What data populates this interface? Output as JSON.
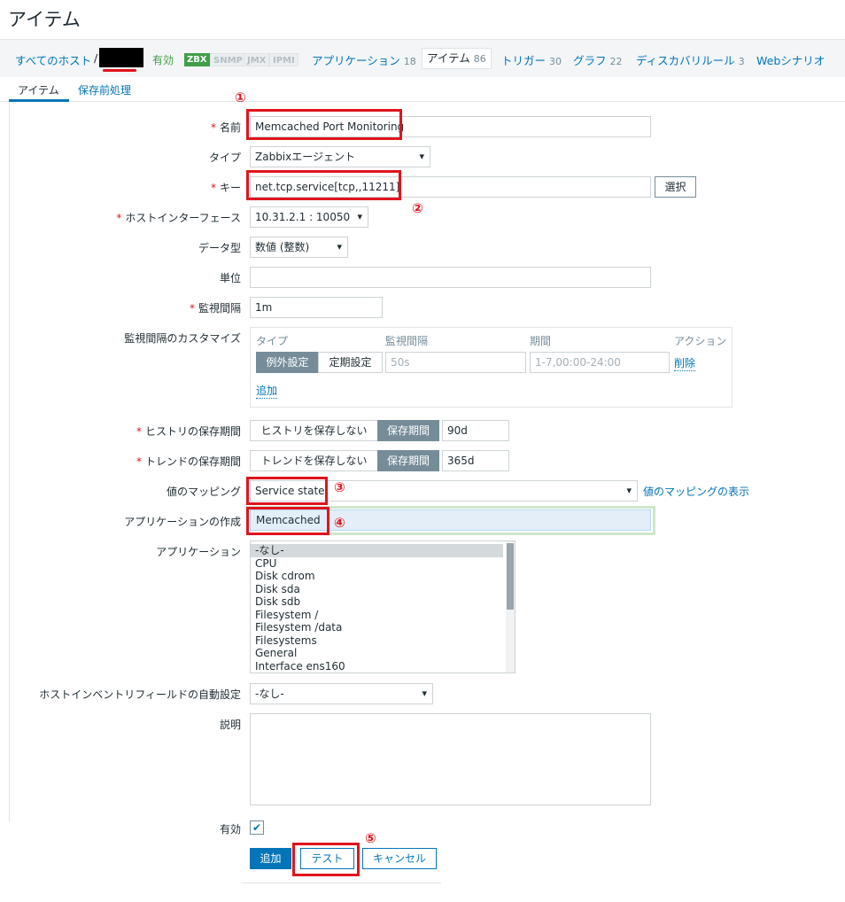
{
  "page": {
    "title": "アイテム"
  },
  "nav": {
    "all_hosts": "すべてのホスト",
    "sep": "/",
    "status": "有効",
    "protocols": [
      "ZBX",
      "SNMP",
      "JMX",
      "IPMI"
    ],
    "links": [
      {
        "label": "アプリケーション",
        "count": "18"
      },
      {
        "label": "アイテム",
        "count": "86"
      },
      {
        "label": "トリガー",
        "count": "30"
      },
      {
        "label": "グラフ",
        "count": "22"
      },
      {
        "label": "ディスカバリルール",
        "count": "3"
      },
      {
        "label": "Webシナリオ",
        "count": ""
      }
    ]
  },
  "tabs": {
    "item": "アイテム",
    "preprocessing": "保存前処理"
  },
  "form": {
    "name_label": "名前",
    "name_value": "Memcached Port Monitoring",
    "type_label": "タイプ",
    "type_value": "Zabbixエージェント",
    "key_label": "キー",
    "key_value": "net.tcp.service[tcp,,11211]",
    "key_select_button": "選択",
    "interface_label": "ホストインターフェース",
    "interface_value": "10.31.2.1 : 10050",
    "datatype_label": "データ型",
    "datatype_value": "数値 (整数)",
    "units_label": "単位",
    "units_value": "",
    "interval_label": "監視間隔",
    "interval_value": "1m",
    "custom_label": "監視間隔のカスタマイズ",
    "custom": {
      "col_type": "タイプ",
      "col_interval": "監視間隔",
      "col_period": "期間",
      "col_action": "アクション",
      "type_flexible": "例外設定",
      "type_scheduling": "定期設定",
      "interval_placeholder": "50s",
      "period_placeholder": "1-7,00:00-24:00",
      "remove": "削除",
      "add": "追加"
    },
    "history_label": "ヒストリの保存期間",
    "history_nostore": "ヒストリを保存しない",
    "history_store": "保存期間",
    "history_value": "90d",
    "trends_label": "トレンドの保存期間",
    "trends_nostore": "トレンドを保存しない",
    "trends_store": "保存期間",
    "trends_value": "365d",
    "valuemap_label": "値のマッピング",
    "valuemap_value": "Service state",
    "valuemap_link": "値のマッピングの表示",
    "newapp_label": "アプリケーションの作成",
    "newapp_value": "Memcached",
    "apps_label": "アプリケーション",
    "apps": [
      "-なし-",
      "CPU",
      "Disk cdrom",
      "Disk sda",
      "Disk sdb",
      "Filesystem /",
      "Filesystem /data",
      "Filesystems",
      "General",
      "Interface ens160"
    ],
    "inventory_label": "ホストインベントリフィールドの自動設定",
    "inventory_value": "-なし-",
    "description_label": "説明",
    "enabled_label": "有効",
    "buttons": {
      "add": "追加",
      "test": "テスト",
      "cancel": "キャンセル"
    }
  },
  "annotations": [
    "①",
    "②",
    "③",
    "④",
    "⑤"
  ]
}
